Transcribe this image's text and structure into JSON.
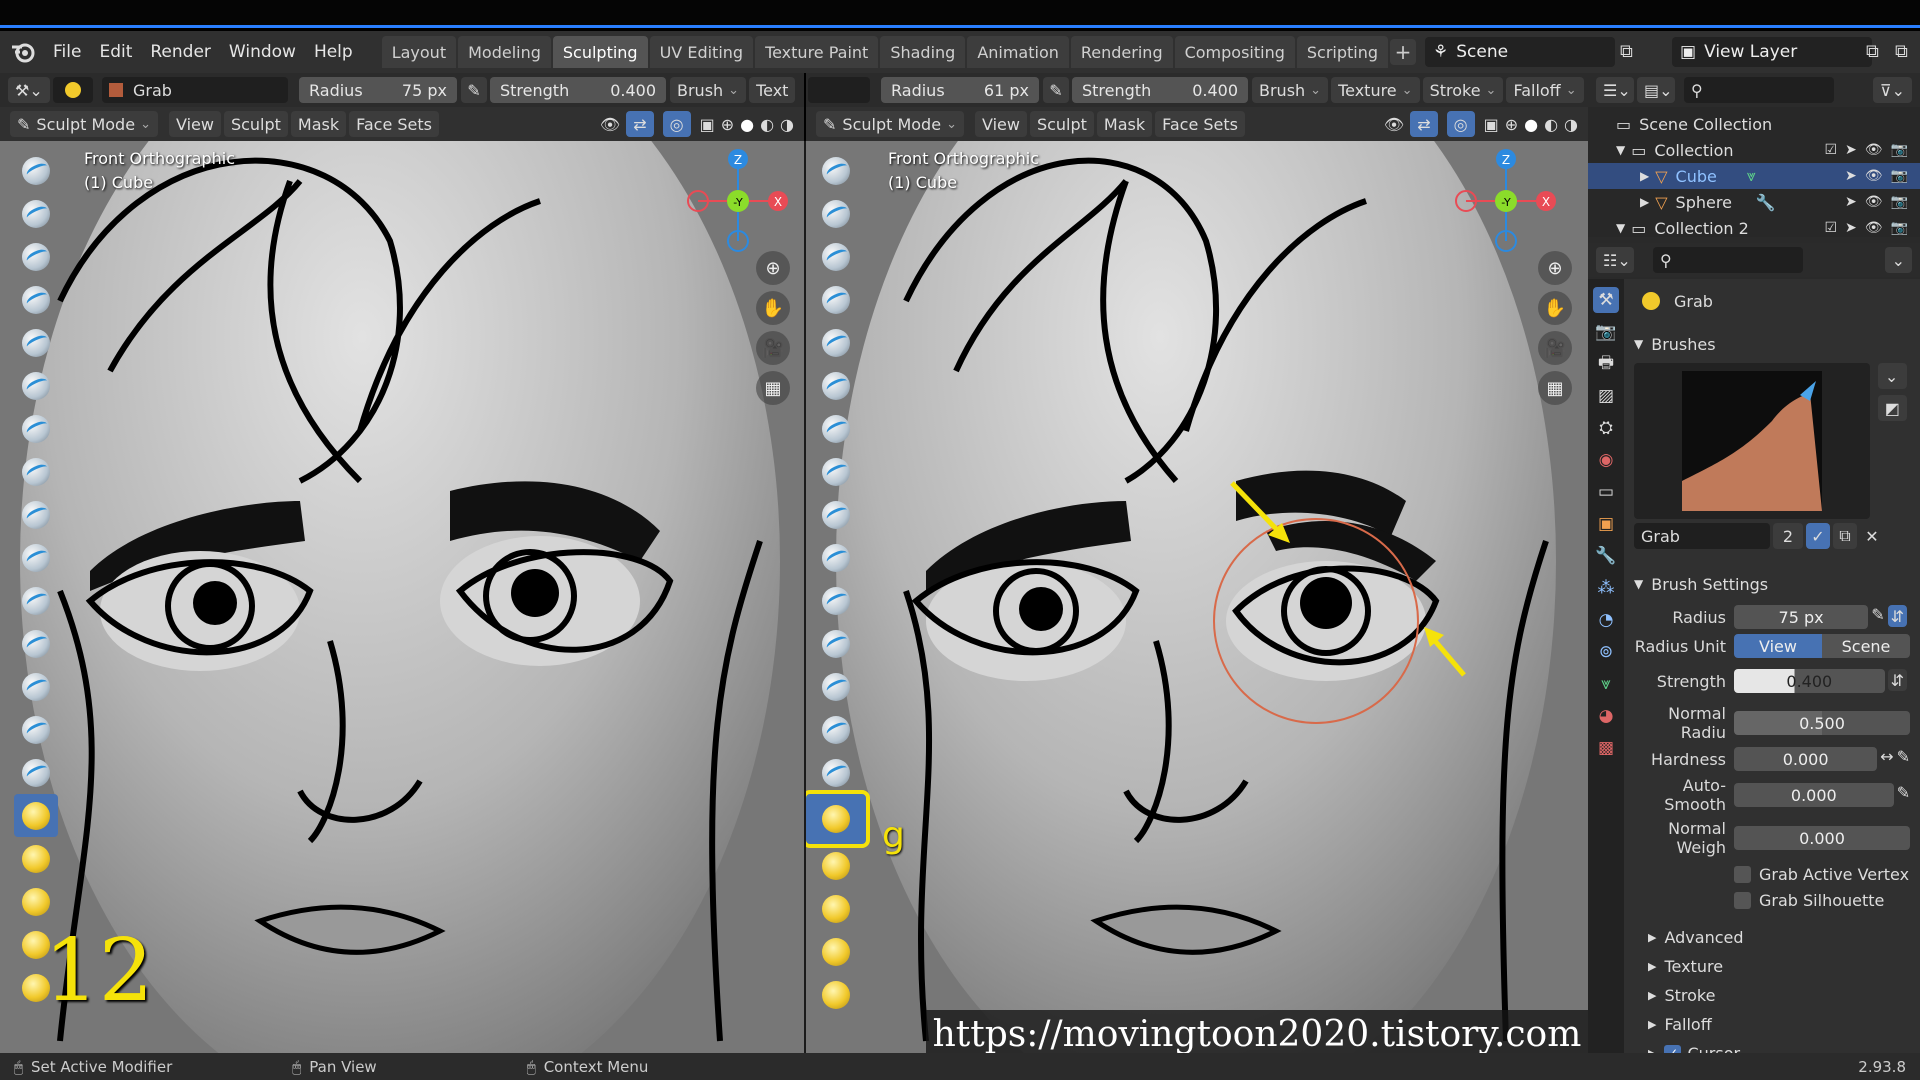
{
  "menubar": {
    "items": [
      "File",
      "Edit",
      "Render",
      "Window",
      "Help"
    ],
    "workspaces": [
      "Layout",
      "Modeling",
      "Sculpting",
      "UV Editing",
      "Texture Paint",
      "Shading",
      "Animation",
      "Rendering",
      "Compositing",
      "Scripting"
    ],
    "active_workspace": "Sculpting",
    "scene": "Scene",
    "view_layer": "View Layer"
  },
  "left_view": {
    "brush_name": "Grab",
    "radius_label": "Radius",
    "radius_value": "75 px",
    "strength_label": "Strength",
    "strength_value": "0.400",
    "brush_menu": "Brush",
    "texture_menu_cut": "Text",
    "mode": "Sculpt Mode",
    "menus": [
      "View",
      "Sculpt",
      "Mask",
      "Face Sets"
    ],
    "view_label": "Front Orthographic",
    "object_label": "(1) Cube",
    "step_number": "12"
  },
  "right_view": {
    "radius_label": "Radius",
    "radius_value": "61 px",
    "strength_label": "Strength",
    "strength_value": "0.400",
    "menus_top": [
      "Brush",
      "Texture",
      "Stroke",
      "Falloff"
    ],
    "mode": "Sculpt Mode",
    "menus": [
      "View",
      "Sculpt",
      "Mask",
      "Face Sets"
    ],
    "view_label": "Front Orthographic",
    "object_label": "(1) Cube",
    "shortcut_key": "g"
  },
  "gizmo": {
    "z": "Z",
    "y": "-Y",
    "x": "X"
  },
  "outliner": {
    "rows": [
      {
        "label": "Scene Collection"
      },
      {
        "label": "Collection"
      },
      {
        "label": "Cube"
      },
      {
        "label": "Sphere"
      },
      {
        "label": "Collection 2"
      }
    ]
  },
  "properties": {
    "active_brush": "Grab",
    "brushes_section": "Brushes",
    "brush_field_name": "Grab",
    "brush_users": "2",
    "brush_settings_section": "Brush Settings",
    "radius_label": "Radius",
    "radius_value": "75 px",
    "radius_unit_label": "Radius Unit",
    "radius_unit_options": [
      "View",
      "Scene"
    ],
    "radius_unit_selected": "View",
    "strength_label": "Strength",
    "strength_value": "0.400",
    "strength_fill": 0.4,
    "normal_radius_label": "Normal Radiu",
    "normal_radius_value": "0.500",
    "normal_radius_fill": 0.5,
    "hardness_label": "Hardness",
    "hardness_value": "0.000",
    "autosmooth_label": "Auto-Smooth",
    "autosmooth_value": "0.000",
    "normal_weight_label": "Normal Weigh",
    "normal_weight_value": "0.000",
    "grab_active_vertex": "Grab Active Vertex",
    "grab_silhouette": "Grab Silhouette",
    "subsections": [
      "Advanced",
      "Texture",
      "Stroke",
      "Falloff",
      "Cursor"
    ]
  },
  "statusbar": {
    "left": "Set Active Modifier",
    "middle": "Pan View",
    "right": "Context Menu",
    "version": "2.93.8"
  },
  "watermark": "https://movingtoon2020.tistory.com",
  "colors": {
    "accent": "#4772b3",
    "highlight_yellow": "#f5e20a",
    "gizmo_x": "#e84b55",
    "gizmo_y": "#8bdc2a",
    "gizmo_z": "#2c8ae0"
  }
}
